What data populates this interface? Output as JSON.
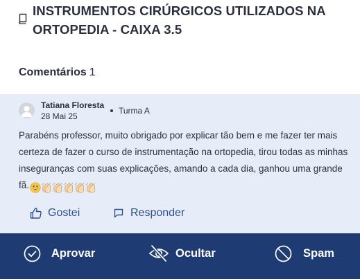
{
  "lesson": {
    "title": "INSTRUMENTOS CIRÚRGICOS UTILIZADOS NA ORTOPEDIA - CAIXA 3.5",
    "icon": "book-icon"
  },
  "comments": {
    "heading": "Comentários",
    "count": "1"
  },
  "comment": {
    "author": "Tatiana Floresta",
    "date": "28 Mai 25",
    "class_name": "Turma A",
    "body": "Parabéns professor, muito obrigado por explicar tão bem e me fazer ter mais certeza de fazer o curso de instrumentação na ortopedia, tirou todas as minhas inseguranças com suas explicações, amando a cada dia, ganhou uma grande fã.",
    "emojis": [
      "grinning-face",
      "clapping-hands",
      "clapping-hands",
      "clapping-hands",
      "clapping-hands",
      "clapping-hands"
    ]
  },
  "actions": {
    "like_label": "Gostei",
    "reply_label": "Responder"
  },
  "moderation": {
    "approve_label": "Aprovar",
    "hide_label": "Ocultar",
    "spam_label": "Spam"
  },
  "colors": {
    "card_background": "#e7edf8",
    "action_link": "#2f4e8f",
    "moderation_bar": "#1f3b73"
  }
}
